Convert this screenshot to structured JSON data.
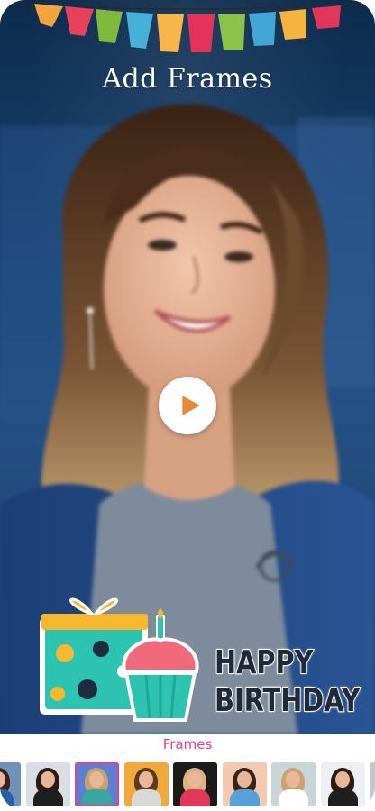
{
  "header": {
    "title": "Add Frames"
  },
  "preview": {
    "play_button_icon": "play-icon"
  },
  "sticker": {
    "line1": "HAPPY",
    "line2": "BIRTHDAY"
  },
  "frames": {
    "label": "Frames",
    "selected_index": 2,
    "thumbnails": [
      {
        "name": "frame-1",
        "bg": "#6f93b8"
      },
      {
        "name": "frame-2",
        "bg": "#d9dde6"
      },
      {
        "name": "frame-3",
        "bg": "#5b7fd3"
      },
      {
        "name": "frame-4",
        "bg": "#f2a93b"
      },
      {
        "name": "frame-5",
        "bg": "#1b1b1b"
      },
      {
        "name": "frame-6",
        "bg": "#f3c9b0"
      },
      {
        "name": "frame-7",
        "bg": "#c9d6d9"
      },
      {
        "name": "frame-8",
        "bg": "#eceff3"
      },
      {
        "name": "frame-9",
        "bg": "#bfc7d4"
      }
    ]
  },
  "colors": {
    "accent": "#e0428c",
    "sky": "#1a4373"
  }
}
